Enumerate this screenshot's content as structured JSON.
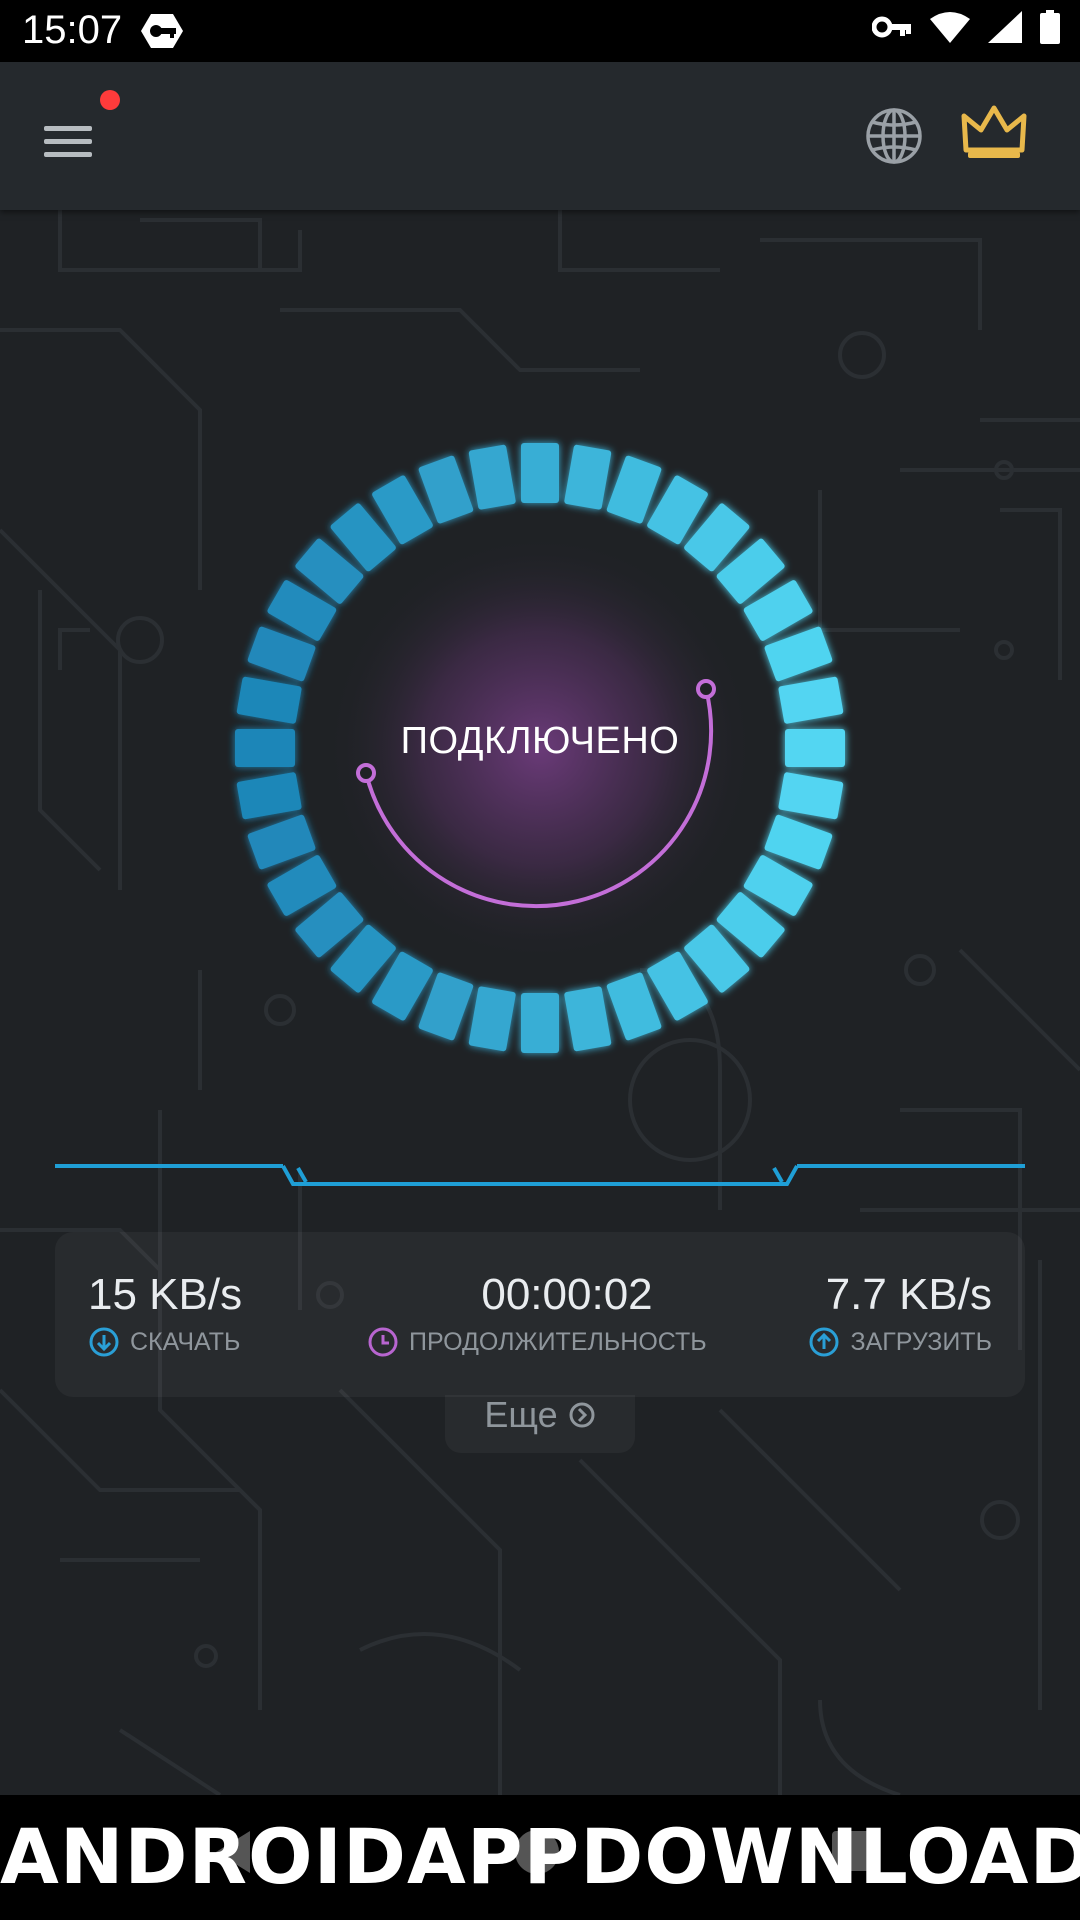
{
  "statusbar": {
    "time": "15:07",
    "icons": [
      "vpn-key-badge-icon",
      "key-icon",
      "wifi-icon",
      "cell-signal-icon",
      "battery-icon"
    ]
  },
  "appbar": {
    "menu_icon": "hamburger-menu-icon",
    "has_notification": true,
    "globe_icon": "globe-icon",
    "premium_icon": "crown-icon",
    "premium_color": "#e8b84b"
  },
  "connection": {
    "status": "ПОДКЛЮЧЕНО",
    "accent_color": "#3bc3ea",
    "arc_color": "#c36ed8"
  },
  "stats": {
    "download": {
      "value": "15 KB/s",
      "label": "СКАЧАТЬ",
      "icon": "download-arrow-icon"
    },
    "duration": {
      "value": "00:00:02",
      "label": "ПРОДОЛЖИТЕЛЬНОСТЬ",
      "icon": "clock-icon"
    },
    "upload": {
      "value": "7.7 KB/s",
      "label": "ЗАГРУЗИТЬ",
      "icon": "upload-arrow-icon"
    }
  },
  "more": {
    "label": "Еще",
    "icon": "chevron-right-circle-icon"
  },
  "watermark": "ANDROIDAPPDOWNLOAD.L"
}
